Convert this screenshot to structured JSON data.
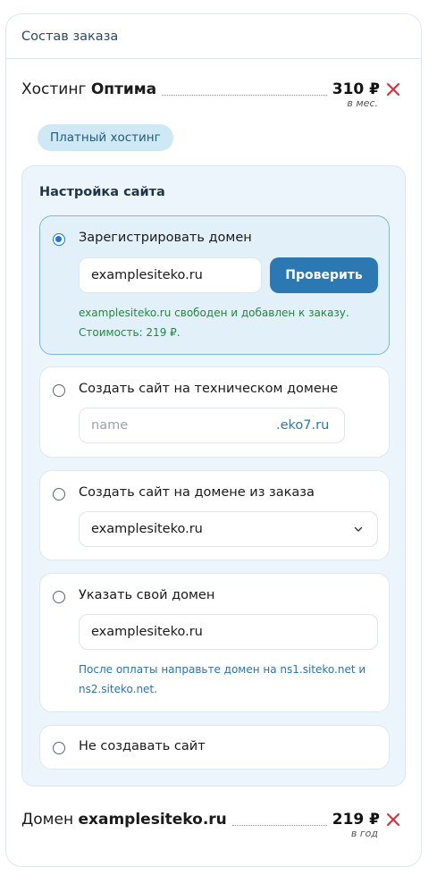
{
  "order": {
    "title": "Состав заказа",
    "hosting": {
      "prefix": "Хостинг",
      "plan": "Оптима",
      "price": "310 ₽",
      "period": "в мес.",
      "tag": "Платный хостинг"
    },
    "domain_item": {
      "prefix": "Домен",
      "domain": "examplesiteko.ru",
      "price": "219 ₽",
      "period": "в год"
    }
  },
  "settings": {
    "title": "Настройка сайта",
    "options": [
      {
        "label": "Зарегистрировать домен",
        "selected": true,
        "input_value": "examplesiteko.ru",
        "button_label": "Проверить",
        "note_line1": "examplesiteko.ru свободен и добавлен к заказу.",
        "note_line2": "Стоимость: 219 ₽."
      },
      {
        "label": "Создать сайт на техническом домене",
        "selected": false,
        "input_placeholder": "name",
        "suffix": ".eko7.ru"
      },
      {
        "label": "Создать сайт на домене из заказа",
        "selected": false,
        "select_value": "examplesiteko.ru"
      },
      {
        "label": "Указать свой домен",
        "selected": false,
        "input_value": "examplesiteko.ru",
        "note_line1": "После оплаты направьте домен на ns1.siteko.net и",
        "note_line2": "ns2.siteko.net."
      },
      {
        "label": "Не создавать сайт",
        "selected": false
      }
    ]
  },
  "colors": {
    "accent": "#2b78b3",
    "remove": "#e0293a",
    "success": "#1f8a3c",
    "selected_bg": "#e2f1f9"
  },
  "icons": {
    "remove": "close-icon",
    "select": "chevron-down-icon"
  }
}
